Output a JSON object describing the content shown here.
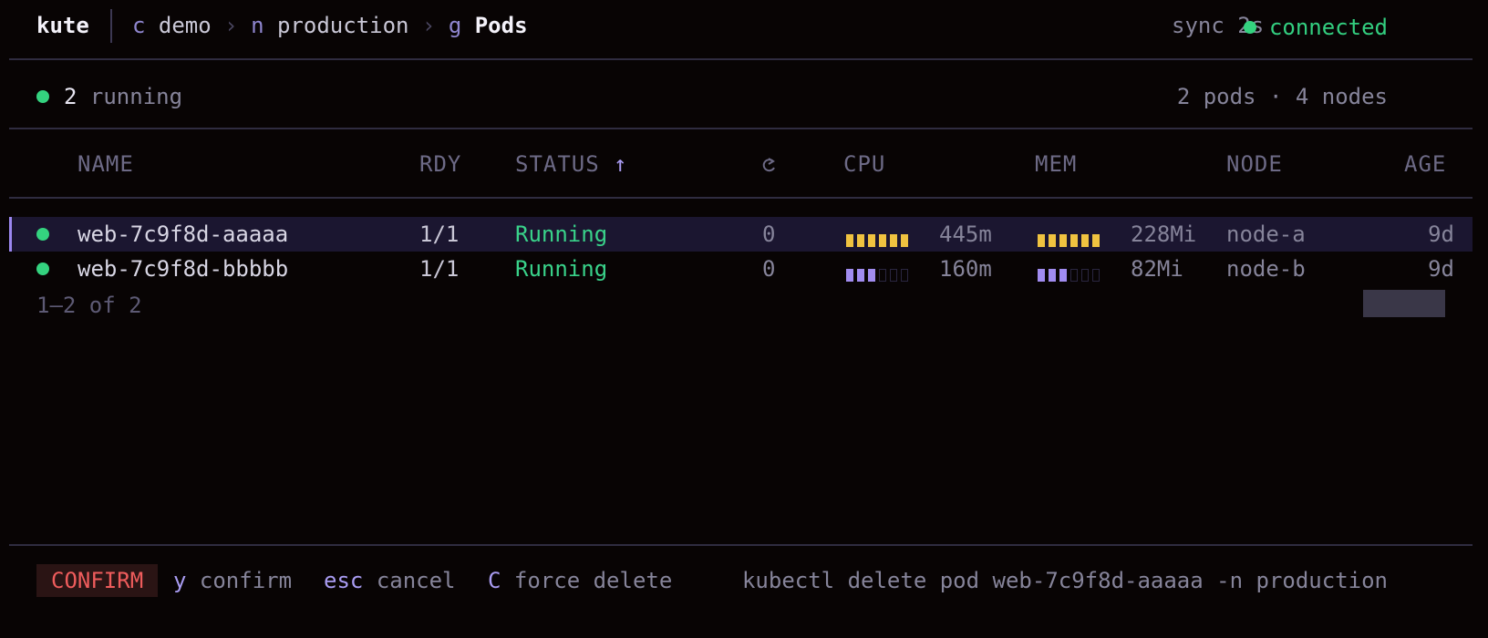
{
  "header": {
    "brand": "kute",
    "breadcrumb": [
      {
        "key": "c",
        "value": "demo"
      },
      {
        "key": "n",
        "value": "production"
      },
      {
        "key": "g",
        "value": "Pods"
      }
    ],
    "separator": "›",
    "sync": "sync 2s",
    "connection": "connected"
  },
  "summary": {
    "running_count": "2",
    "running_label": "running",
    "totals": "2 pods · 4 nodes"
  },
  "columns": {
    "name": "NAME",
    "ready": "RDY",
    "status": "STATUS ↑",
    "restarts_icon": "refresh-icon",
    "cpu": "CPU",
    "mem": "MEM",
    "node": "NODE",
    "age": "AGE"
  },
  "pods": [
    {
      "name": "web-7c9f8d-aaaaa",
      "ready": "1/1",
      "status": "Running",
      "restarts": "0",
      "cpu": "445m",
      "cpu_level": 6,
      "mem": "228Mi",
      "mem_level": 6,
      "node": "node-a",
      "age": "9d",
      "selected": true
    },
    {
      "name": "web-7c9f8d-bbbbb",
      "ready": "1/1",
      "status": "Running",
      "restarts": "0",
      "cpu": "160m",
      "cpu_level": 3,
      "mem": "82Mi",
      "mem_level": 3,
      "node": "node-b",
      "age": "9d",
      "selected": false
    }
  ],
  "pagination": "1–2 of 2",
  "footer": {
    "mode": "CONFIRM",
    "hints": [
      {
        "key": "y",
        "desc": "confirm"
      },
      {
        "key": "esc",
        "desc": "cancel"
      },
      {
        "key": "C",
        "desc": "force delete"
      }
    ],
    "command": "kubectl delete pod web-7c9f8d-aaaaa -n production"
  },
  "colors": {
    "accent": "#9b87f0",
    "running": "#39d28a",
    "danger": "#ee5c5c",
    "meter_high": "#f0c340",
    "meter_low": "#a18cf0"
  }
}
